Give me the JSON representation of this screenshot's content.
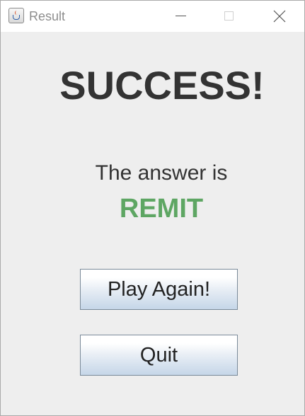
{
  "window": {
    "title": "Result"
  },
  "result": {
    "headline": "SUCCESS!",
    "answer_label": "The answer is",
    "answer_word": "REMIT"
  },
  "buttons": {
    "play_again": "Play Again!",
    "quit": "Quit"
  },
  "colors": {
    "answer_accent": "#5ea663",
    "text": "#333333",
    "background": "#eeeeee"
  }
}
